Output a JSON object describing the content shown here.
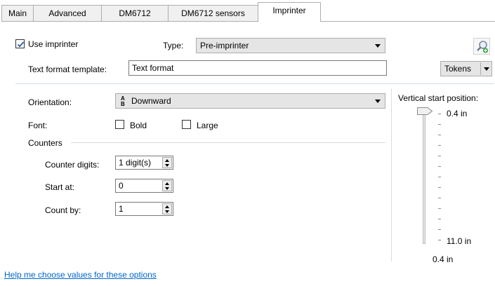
{
  "tabs": [
    {
      "label": "Main",
      "active": false
    },
    {
      "label": "Advanced",
      "active": false
    },
    {
      "label": "DM6712",
      "active": false
    },
    {
      "label": "DM6712 sensors",
      "active": false
    },
    {
      "label": "Imprinter",
      "active": true
    }
  ],
  "imprinter": {
    "use_label": "Use imprinter",
    "use_checked": true,
    "type_label": "Type:",
    "type_value": "Pre-imprinter",
    "text_template_label": "Text format template:",
    "text_template_value": "Text format",
    "tokens_label": "Tokens",
    "search_icon": "magnifier-plus-icon"
  },
  "orientation": {
    "label": "Orientation:",
    "value": "Downward",
    "icon": "text-rotate-down-icon"
  },
  "font": {
    "label": "Font:",
    "bold_label": "Bold",
    "bold_checked": false,
    "large_label": "Large",
    "large_checked": false
  },
  "counters": {
    "group_label": "Counters",
    "digits_label": "Counter digits:",
    "digits_value": "1 digit(s)",
    "start_label": "Start at:",
    "start_value": "0",
    "countby_label": "Count by:",
    "countby_value": "1"
  },
  "vertical": {
    "label": "Vertical start position:",
    "top_value": "0.4 in",
    "bottom_value": "11.0 in",
    "current_value": "0.4 in",
    "slider_fraction": 0.0
  },
  "help_link": "Help me choose values for these options",
  "colors": {
    "link": "#0066cc",
    "check": "#2a5ea6"
  }
}
